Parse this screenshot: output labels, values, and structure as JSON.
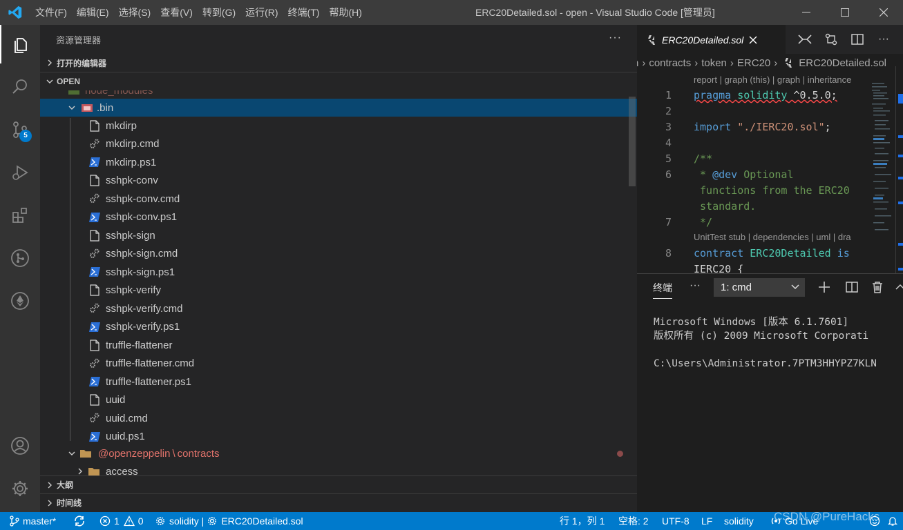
{
  "window": {
    "title": "ERC20Detailed.sol - open - Visual Studio Code [管理员]",
    "menu": [
      "文件(F)",
      "编辑(E)",
      "选择(S)",
      "查看(V)",
      "转到(G)",
      "运行(R)",
      "终端(T)",
      "帮助(H)"
    ]
  },
  "activity": {
    "source_control_badge": "5"
  },
  "sidebar": {
    "title": "资源管理器",
    "more": "···",
    "open_editors": "打开的编辑器",
    "folder": "OPEN",
    "cut_row": "node_modules",
    "selected": ".bin",
    "files": [
      {
        "name": "mkdirp",
        "type": "file"
      },
      {
        "name": "mkdirp.cmd",
        "type": "cmd"
      },
      {
        "name": "mkdirp.ps1",
        "type": "ps1"
      },
      {
        "name": "sshpk-conv",
        "type": "file"
      },
      {
        "name": "sshpk-conv.cmd",
        "type": "cmd"
      },
      {
        "name": "sshpk-conv.ps1",
        "type": "ps1"
      },
      {
        "name": "sshpk-sign",
        "type": "file"
      },
      {
        "name": "sshpk-sign.cmd",
        "type": "cmd"
      },
      {
        "name": "sshpk-sign.ps1",
        "type": "ps1"
      },
      {
        "name": "sshpk-verify",
        "type": "file"
      },
      {
        "name": "sshpk-verify.cmd",
        "type": "cmd"
      },
      {
        "name": "sshpk-verify.ps1",
        "type": "ps1"
      },
      {
        "name": "truffle-flattener",
        "type": "file"
      },
      {
        "name": "truffle-flattener.cmd",
        "type": "cmd"
      },
      {
        "name": "truffle-flattener.ps1",
        "type": "ps1"
      },
      {
        "name": "uuid",
        "type": "file"
      },
      {
        "name": "uuid.cmd",
        "type": "cmd"
      },
      {
        "name": "uuid.ps1",
        "type": "ps1"
      }
    ],
    "oz_folder": "@openzeppelin",
    "oz_sep": "\\",
    "oz_sub": "contracts",
    "access": "access",
    "outline": "大纲",
    "timeline": "时间线"
  },
  "editor": {
    "tab": "ERC20Detailed.sol",
    "breadcrumbs": [
      "n",
      "contracts",
      "token",
      "ERC20",
      "ERC20Detailed.sol"
    ],
    "codelens_top": "report | graph (this) | graph | inheritance",
    "codelens_contract": "UnitTest stub | dependencies | uml | dra",
    "lines": [
      {
        "n": "1",
        "tokens": [
          {
            "t": "pragma",
            "c": "kw sq"
          },
          {
            "t": " ",
            "c": "pl sq"
          },
          {
            "t": "solidity",
            "c": "ty sq"
          },
          {
            "t": " ^0.5.0;",
            "c": "pl sq"
          }
        ]
      },
      {
        "n": "2",
        "tokens": []
      },
      {
        "n": "3",
        "tokens": [
          {
            "t": "import",
            "c": "kw"
          },
          {
            "t": " ",
            "c": "pl"
          },
          {
            "t": "\"./IERC20.sol\"",
            "c": "str"
          },
          {
            "t": ";",
            "c": "pl"
          }
        ]
      },
      {
        "n": "4",
        "tokens": []
      },
      {
        "n": "5",
        "tokens": [
          {
            "t": "/**",
            "c": "cm"
          }
        ]
      },
      {
        "n": "6",
        "tokens": [
          {
            "t": " * ",
            "c": "cm"
          },
          {
            "t": "@dev",
            "c": "kw"
          },
          {
            "t": " Optional",
            "c": "cm"
          }
        ]
      },
      {
        "n": "",
        "tokens": [
          {
            "t": " functions from the ERC20",
            "c": "cm"
          }
        ]
      },
      {
        "n": "",
        "tokens": [
          {
            "t": " standard.",
            "c": "cm"
          }
        ]
      },
      {
        "n": "7",
        "tokens": [
          {
            "t": " */",
            "c": "cm"
          }
        ]
      },
      {
        "n": "8",
        "tokens": [
          {
            "t": "contract",
            "c": "kw"
          },
          {
            "t": " ",
            "c": "pl"
          },
          {
            "t": "ERC20Detailed",
            "c": "ty"
          },
          {
            "t": " ",
            "c": "pl"
          },
          {
            "t": "is",
            "c": "kw"
          }
        ]
      },
      {
        "n": "",
        "tokens": [
          {
            "t": "IERC20 {",
            "c": "pl"
          }
        ]
      }
    ]
  },
  "panel": {
    "tab": "终端",
    "more": "···",
    "terminal_select": "1: cmd",
    "terminal_lines": [
      "Microsoft Windows [版本 6.1.7601]",
      "版权所有 (c) 2009 Microsoft Corporati",
      "",
      "C:\\Users\\Administrator.7PTM3HHYPZ7KLN"
    ]
  },
  "statusbar": {
    "branch": "master*",
    "errors": "1",
    "warnings": "0",
    "solidity_status": "solidity | ",
    "file": "ERC20Detailed.sol",
    "position": "行 1，列 1",
    "spaces": "空格: 2",
    "encoding": "UTF-8",
    "eol": "LF",
    "language": "solidity",
    "golive": "Go Live",
    "watermark": "CSDN @PureHacks"
  }
}
